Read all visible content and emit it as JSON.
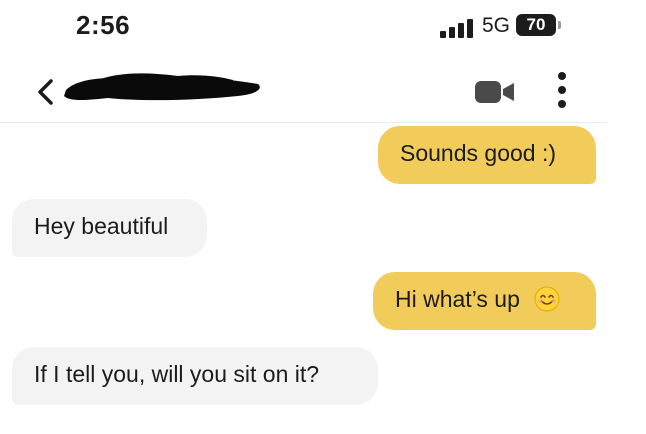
{
  "status_bar": {
    "time": "2:56",
    "network": "5G",
    "battery": "70"
  },
  "header": {
    "back_icon": "chevron-left-icon",
    "video_icon": "video-call-icon",
    "more_icon": "more-vertical-icon"
  },
  "messages": [
    {
      "direction": "sent",
      "text": "Sounds good :)"
    },
    {
      "direction": "received",
      "text": "Hey beautiful"
    },
    {
      "direction": "sent",
      "text": "Hi what’s up",
      "emoji": "smiling-face-icon"
    },
    {
      "direction": "received",
      "text": "If I tell you, will you sit on it?"
    }
  ],
  "colors": {
    "sent_bubble": "#f2cc5b",
    "received_bubble": "#f3f3f3",
    "text": "#1c1c1c"
  }
}
